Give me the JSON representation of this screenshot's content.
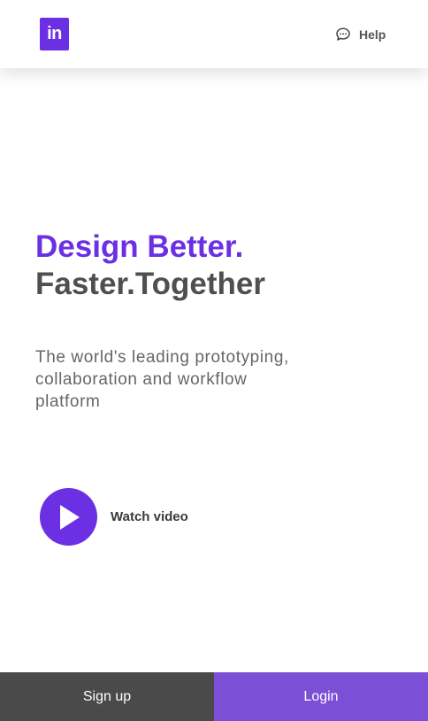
{
  "header": {
    "logo_text": "in",
    "help_label": "Help",
    "help_icon": "chat-bubble-icon"
  },
  "hero": {
    "title_line1": "Design Better.",
    "title_line2": "Faster.Together",
    "tagline": "The world's leading prototyping, collaboration and workflow platform"
  },
  "video": {
    "label": "Watch video",
    "icon": "play-icon"
  },
  "footer": {
    "signup_label": "Sign up",
    "login_label": "Login"
  },
  "colors": {
    "brand_purple": "#6b30e3",
    "login_purple": "#7b4fd6",
    "signup_gray": "#4a4a4a",
    "title_gray": "#4f4f4f"
  }
}
